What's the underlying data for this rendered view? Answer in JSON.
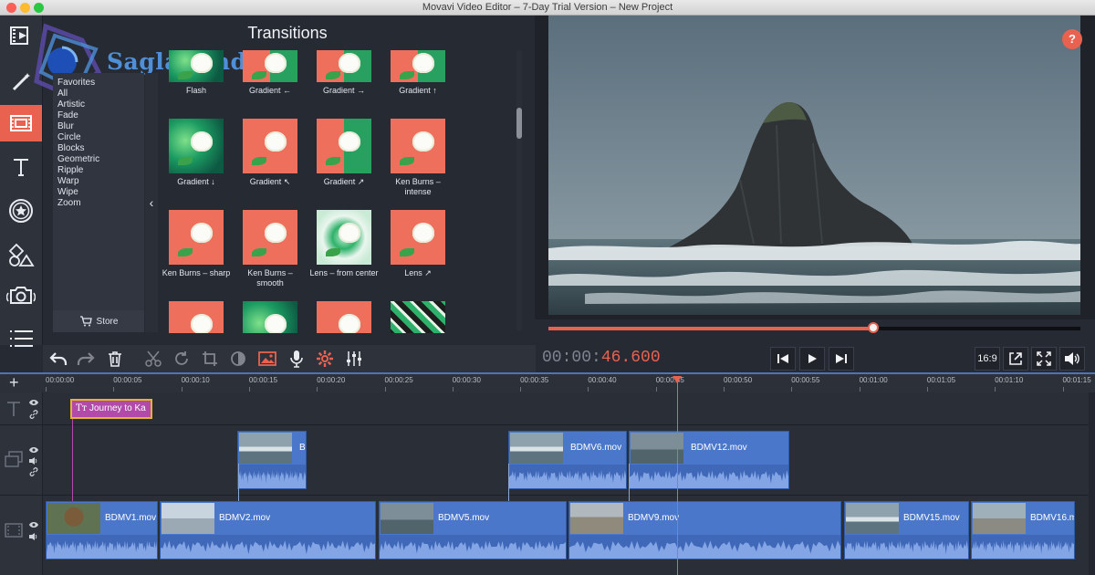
{
  "window": {
    "title": "Movavi Video Editor – 7-Day Trial Version – New Project"
  },
  "watermark": {
    "text": "Saglamindir"
  },
  "sidebar": {
    "items": [
      {
        "name": "import",
        "icon": "film-import-icon"
      },
      {
        "name": "filters",
        "icon": "magic-wand-icon"
      },
      {
        "name": "transitions",
        "icon": "transitions-icon",
        "active": true
      },
      {
        "name": "titles",
        "icon": "text-icon"
      },
      {
        "name": "stickers",
        "icon": "star-icon"
      },
      {
        "name": "callouts",
        "icon": "shapes-icon"
      },
      {
        "name": "record",
        "icon": "camera-icon"
      },
      {
        "name": "more",
        "icon": "list-icon"
      }
    ]
  },
  "transitions": {
    "title": "Transitions",
    "categories": [
      "Favorites",
      "All",
      "Artistic",
      "Fade",
      "Blur",
      "Circle",
      "Blocks",
      "Geometric",
      "Ripple",
      "Warp",
      "Wipe",
      "Zoom"
    ],
    "store_label": "Store",
    "items": [
      {
        "label": "Flash",
        "variant": "green"
      },
      {
        "label": "Gradient ←",
        "variant": "split"
      },
      {
        "label": "Gradient →",
        "variant": "split"
      },
      {
        "label": "Gradient ↑",
        "variant": "split"
      },
      {
        "label": "Gradient ↓",
        "variant": "green"
      },
      {
        "label": "Gradient ↖",
        "variant": "coral"
      },
      {
        "label": "Gradient ↗",
        "variant": "split"
      },
      {
        "label": "Ken Burns – intense",
        "variant": "coral"
      },
      {
        "label": "Ken Burns – sharp",
        "variant": "coral"
      },
      {
        "label": "Ken Burns – smooth",
        "variant": "coral"
      },
      {
        "label": "Lens – from center",
        "variant": "lens"
      },
      {
        "label": "Lens ↗",
        "variant": "coral"
      },
      {
        "label": "",
        "variant": "coral"
      },
      {
        "label": "",
        "variant": "green"
      },
      {
        "label": "",
        "variant": "coral"
      },
      {
        "label": "",
        "variant": "mosaic"
      }
    ]
  },
  "player": {
    "help_label": "?",
    "progress": 0.61,
    "timecode_dim": "00:00:",
    "timecode_hi": "46.600",
    "aspect_label": "16:9"
  },
  "toolbar": {
    "buttons": [
      "undo-icon",
      "redo-icon",
      "trash-icon",
      "scissors-icon",
      "rotate-icon",
      "crop-icon",
      "color-adjust-icon",
      "image-icon",
      "microphone-icon",
      "settings-icon",
      "equalizer-icon"
    ]
  },
  "timeline": {
    "ruler_labels": [
      "00:00:00",
      "00:00:05",
      "00:00:10",
      "00:00:15",
      "00:00:20",
      "00:00:25",
      "00:00:30",
      "00:00:35",
      "00:00:40",
      "00:00:45",
      "00:00:50",
      "00:00:55",
      "00:01:00",
      "00:01:05",
      "00:01:10",
      "00:01:15"
    ],
    "title_clip": "Journey to Ka",
    "overlay_clips": [
      {
        "name": "BI",
        "thumb": "sea"
      },
      {
        "name": "BDMV6.mov",
        "thumb": "sea"
      },
      {
        "name": "BDMV12.mov",
        "thumb": "rock"
      }
    ],
    "main_clips": [
      {
        "name": "BDMV1.mov",
        "thumb": "person"
      },
      {
        "name": "BDMV2.mov",
        "thumb": "kayak"
      },
      {
        "name": "BDMV5.mov",
        "thumb": "rock"
      },
      {
        "name": "BDMV9.mov",
        "thumb": "horses"
      },
      {
        "name": "BDMV15.mov",
        "thumb": "sea"
      },
      {
        "name": "BDMV16.m",
        "thumb": "beach"
      }
    ]
  },
  "colors": {
    "accent": "#e8624f",
    "clip": "#4a77c9",
    "title_clip": "#b14aa8"
  }
}
